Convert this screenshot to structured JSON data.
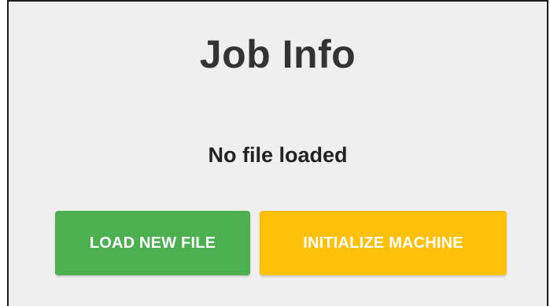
{
  "panel": {
    "title": "Job Info",
    "file_status": "No file loaded"
  },
  "actions": {
    "load_label": "LOAD NEW FILE",
    "init_label": "INITIALIZE MACHINE"
  },
  "colors": {
    "panel_bg": "#efefef",
    "load_button": "#4caf50",
    "init_button": "#ffc107",
    "button_text": "#ffffff",
    "title_text": "#333333"
  }
}
